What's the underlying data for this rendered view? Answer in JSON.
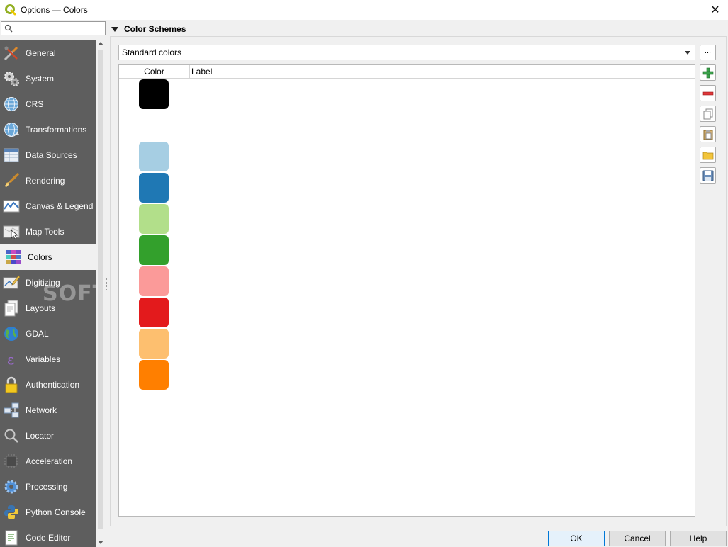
{
  "window": {
    "title": "Options — Colors",
    "close_glyph": "✕"
  },
  "search": {
    "placeholder": "",
    "value": ""
  },
  "sidebar": {
    "items": [
      {
        "label": "General",
        "icon": "tools-icon"
      },
      {
        "label": "System",
        "icon": "gears-icon"
      },
      {
        "label": "CRS",
        "icon": "globe-grid-icon"
      },
      {
        "label": "Transformations",
        "icon": "globe-transform-icon"
      },
      {
        "label": "Data Sources",
        "icon": "table-icon"
      },
      {
        "label": "Rendering",
        "icon": "paintbrush-icon"
      },
      {
        "label": "Canvas & Legend",
        "icon": "map-canvas-icon"
      },
      {
        "label": "Map Tools",
        "icon": "map-pointer-icon"
      },
      {
        "label": "Colors",
        "icon": "color-grid-icon",
        "active": true
      },
      {
        "label": "Digitizing",
        "icon": "pencil-map-icon"
      },
      {
        "label": "Layouts",
        "icon": "layout-pages-icon"
      },
      {
        "label": "GDAL",
        "icon": "earth-icon"
      },
      {
        "label": "Variables",
        "icon": "epsilon-icon"
      },
      {
        "label": "Authentication",
        "icon": "padlock-icon"
      },
      {
        "label": "Network",
        "icon": "network-icon"
      },
      {
        "label": "Locator",
        "icon": "magnifier-icon"
      },
      {
        "label": "Acceleration",
        "icon": "chip-icon"
      },
      {
        "label": "Processing",
        "icon": "cog-icon"
      },
      {
        "label": "Python Console",
        "icon": "python-icon"
      },
      {
        "label": "Code Editor",
        "icon": "code-file-icon"
      }
    ]
  },
  "group": {
    "title": "Color Schemes",
    "scheme_selected": "Standard colors",
    "more_button_label": "...",
    "table": {
      "columns": [
        "Color",
        "Label"
      ],
      "rows": [
        {
          "color": "#000000",
          "label": ""
        },
        {
          "color": "#ffffff",
          "label": ""
        },
        {
          "color": "#a6cee3",
          "label": ""
        },
        {
          "color": "#1f78b4",
          "label": ""
        },
        {
          "color": "#b2df8a",
          "label": ""
        },
        {
          "color": "#33a02c",
          "label": ""
        },
        {
          "color": "#fb9a99",
          "label": ""
        },
        {
          "color": "#e31a1c",
          "label": ""
        },
        {
          "color": "#fdbf6f",
          "label": ""
        },
        {
          "color": "#ff7f00",
          "label": ""
        }
      ]
    },
    "tools": [
      "add-color-icon",
      "remove-color-icon",
      "copy-colors-icon",
      "paste-colors-icon",
      "import-colors-icon",
      "export-colors-icon"
    ]
  },
  "buttons": {
    "ok": "OK",
    "cancel": "Cancel",
    "help": "Help"
  },
  "watermark": "SOFTPEDIA",
  "colors": {
    "sidebar_bg": "#5e5e5e",
    "accent": "#0078d7"
  }
}
